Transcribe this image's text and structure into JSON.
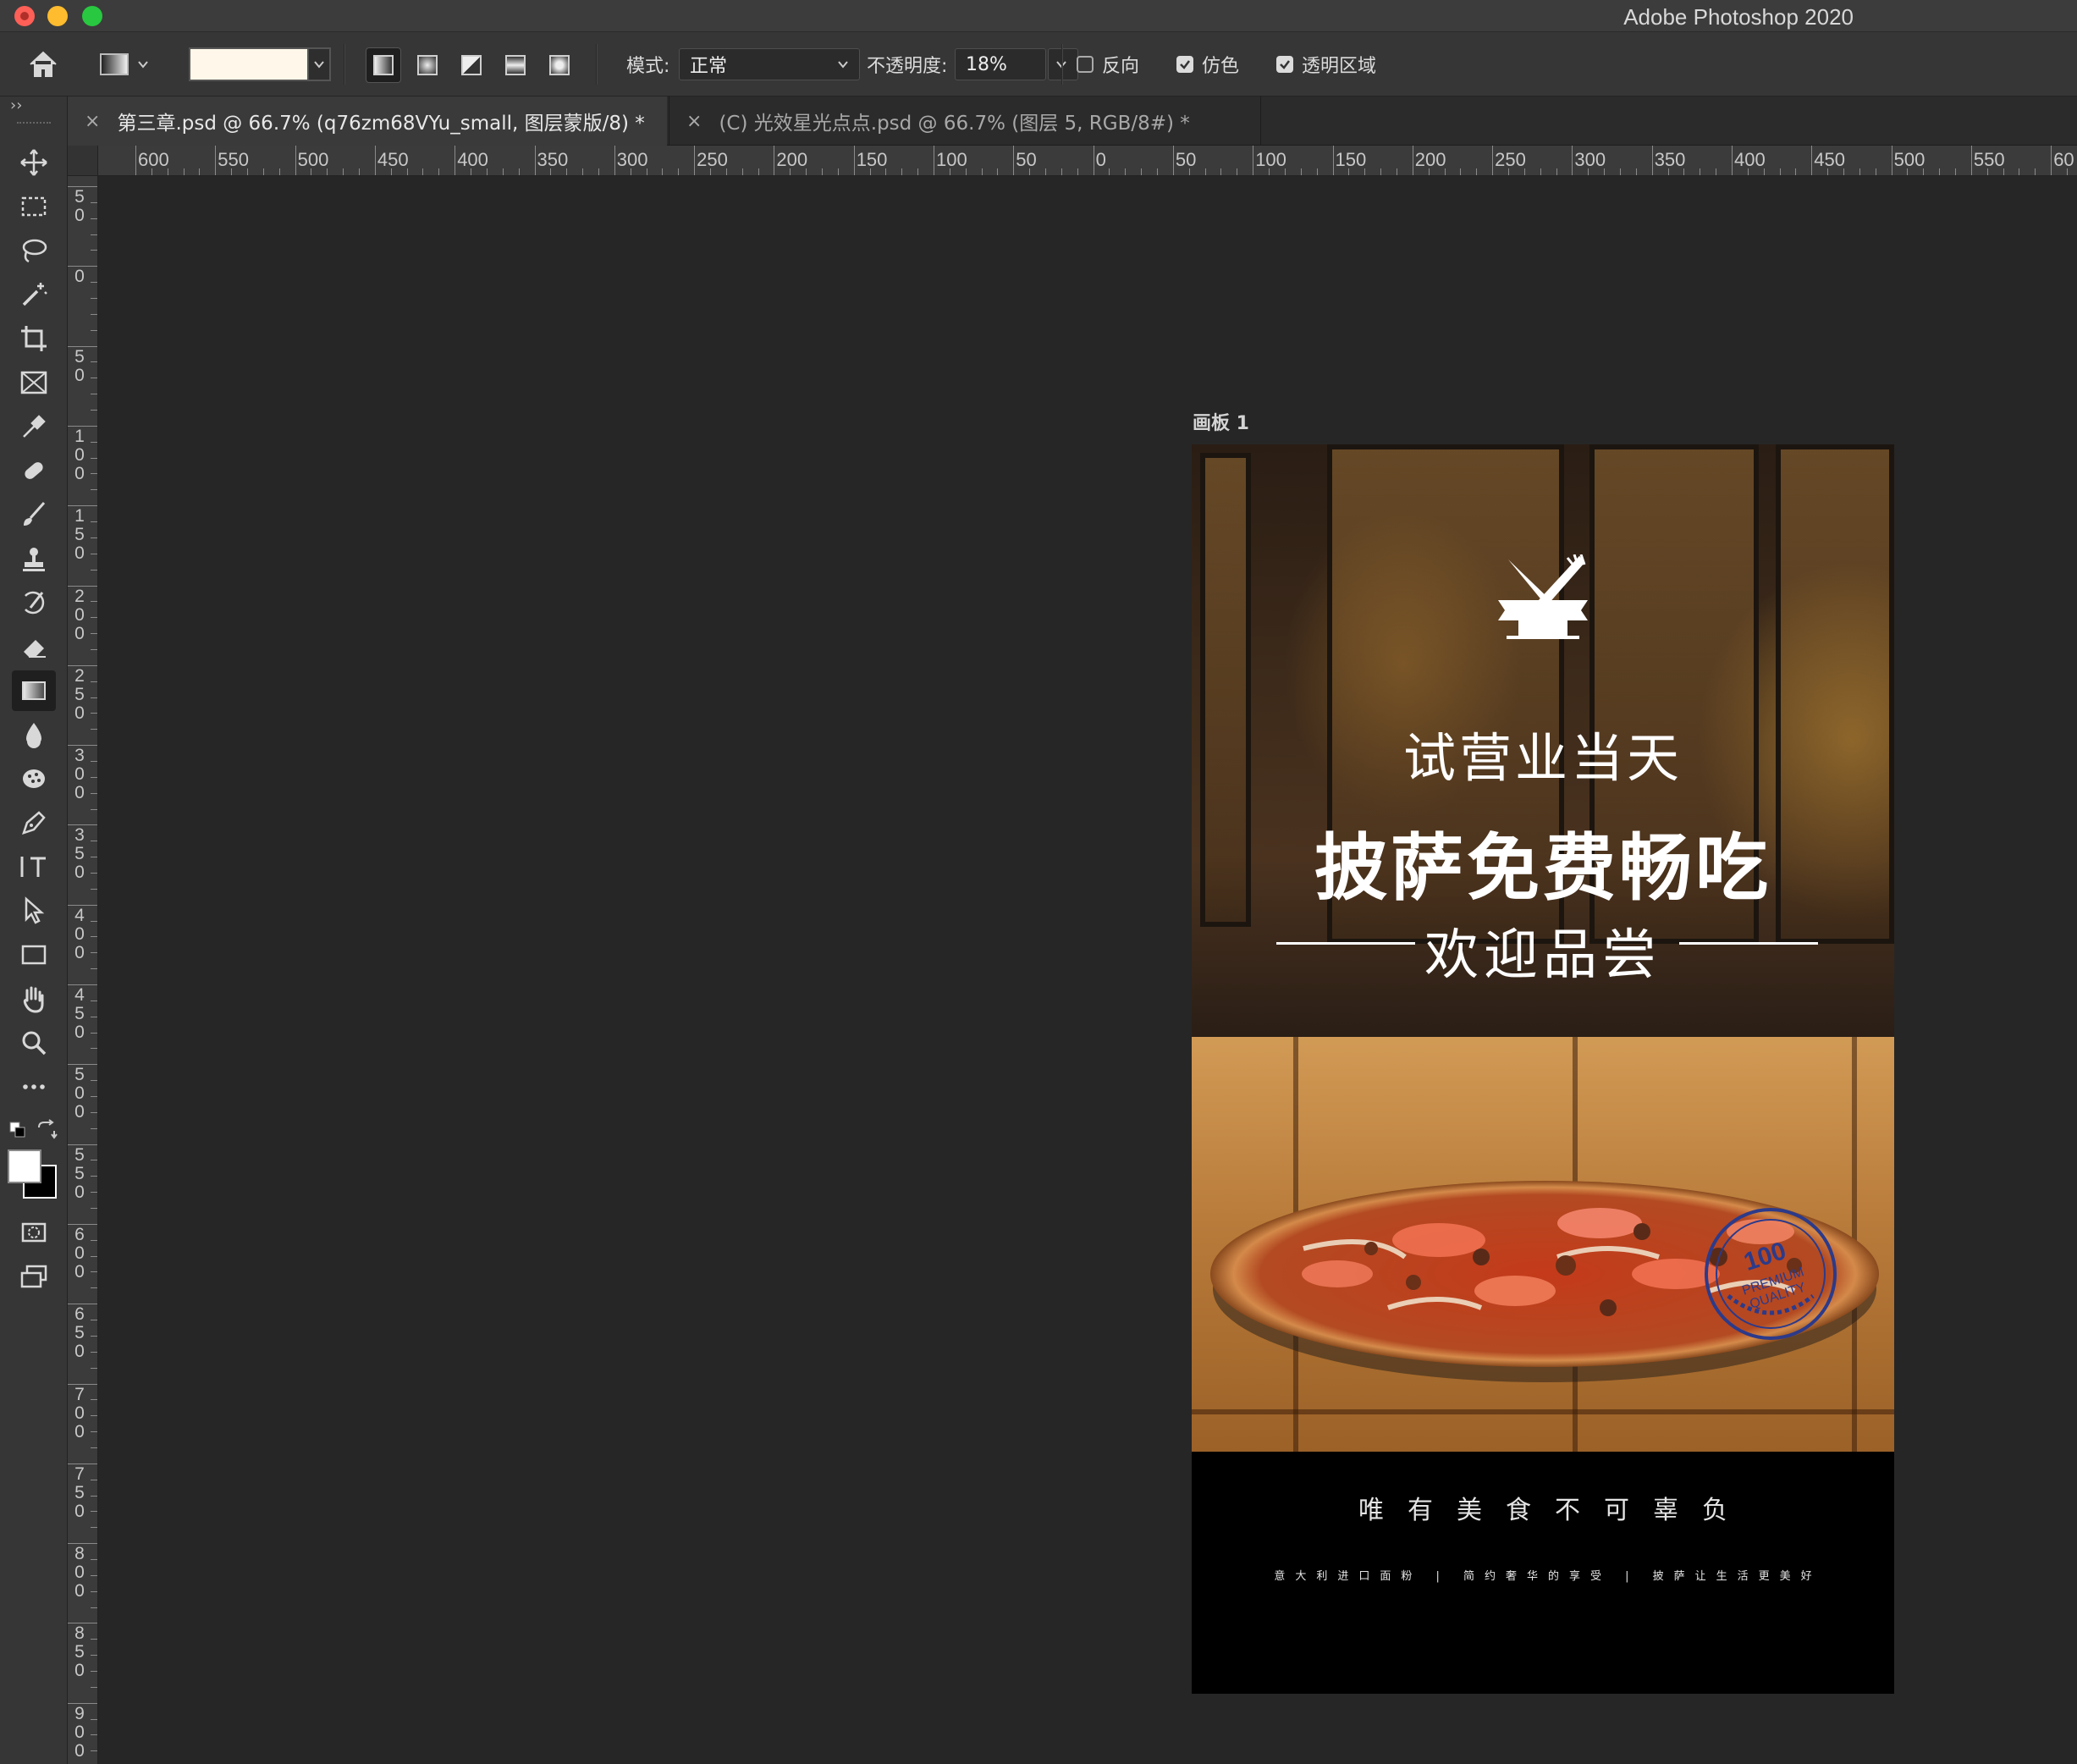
{
  "window": {
    "app_title": "Adobe Photoshop 2020"
  },
  "options_bar": {
    "mode_label": "模式:",
    "mode_value": "正常",
    "opacity_label": "不透明度:",
    "opacity_value": "18%",
    "reverse_label": "反向",
    "reverse_checked": false,
    "dither_label": "仿色",
    "dither_checked": true,
    "transparency_label": "透明区域",
    "transparency_checked": true,
    "foreground_swatch_color": "#fff8ea"
  },
  "tabs": [
    {
      "close": "×",
      "label": "第三章.psd @ 66.7% (q76zm68VYu_small, 图层蒙版/8) *",
      "active": true
    },
    {
      "close": "×",
      "label": "(C) 光效星光点点.psd @ 66.7% (图层 5, RGB/8#) *",
      "active": false
    }
  ],
  "ruler_h": [
    "600",
    "550",
    "500",
    "450",
    "400",
    "350",
    "300",
    "250",
    "200",
    "150",
    "100",
    "50",
    "0",
    "50",
    "100",
    "150",
    "200",
    "250",
    "300",
    "350",
    "400",
    "450",
    "500",
    "550",
    "60"
  ],
  "ruler_v": [
    "50",
    "0",
    "50",
    "100",
    "150",
    "200",
    "250",
    "300",
    "350",
    "400",
    "450",
    "500",
    "550",
    "600",
    "650",
    "700",
    "750",
    "800",
    "850",
    "900"
  ],
  "toolbar": {
    "collapse": "››",
    "tools": [
      "move-tool",
      "marquee-tool",
      "lasso-tool",
      "magic-wand-tool",
      "crop-tool",
      "frame-tool",
      "eyedropper-tool",
      "healing-brush-tool",
      "brush-tool",
      "clone-stamp-tool",
      "history-brush-tool",
      "eraser-tool",
      "gradient-tool",
      "blur-tool",
      "sponge-tool",
      "pen-tool",
      "type-tool",
      "path-selection-tool",
      "rectangle-tool",
      "hand-tool",
      "zoom-tool",
      "more-tools"
    ],
    "active_tool": "gradient-tool"
  },
  "artboard": {
    "label": "画板 1",
    "headline_1": "试营业当天",
    "headline_2": "披萨免费畅吃",
    "headline_3": "欢迎品尝",
    "slogan": "唯有美食不可辜负",
    "fineprint": "意大利进口面粉 | 简约奢华的享受 | 披萨让生活更美好",
    "stamp_number": "100",
    "stamp_line_1": "PREMIUM",
    "stamp_line_2": "QUALITY"
  }
}
